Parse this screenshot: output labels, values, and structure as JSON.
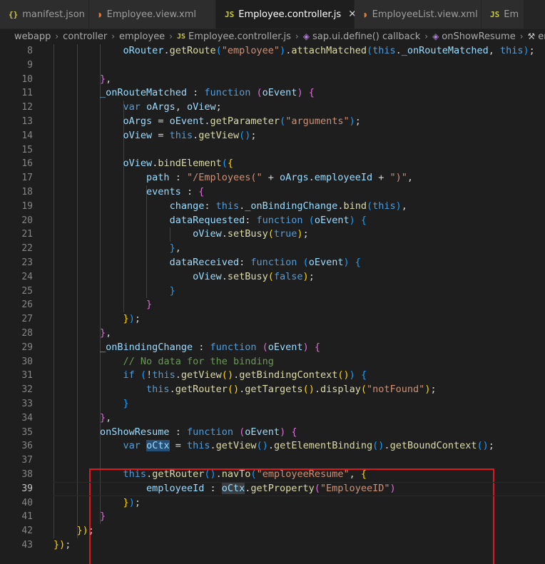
{
  "tabs": [
    {
      "icon": "{}",
      "label": "manifest.json"
    },
    {
      "icon": "RSS",
      "label": "Employee.view.xml"
    },
    {
      "icon": "JS",
      "label": "Employee.controller.js",
      "active": true
    },
    {
      "icon": "RSS",
      "label": "EmployeeList.view.xml"
    },
    {
      "icon": "JS",
      "label": "Em"
    }
  ],
  "breadcrumb": [
    "webapp",
    "controller",
    "employee",
    "Employee.controller.js",
    "sap.ui.define() callback",
    "onShowResume",
    "emplo"
  ],
  "breadcrumb_icons": {
    "js": "JS",
    "symbol": "◈",
    "wrench": "🔧"
  },
  "editor": {
    "current_line": 39,
    "lines": [
      {
        "n": "8",
        "t": "            oRouter.getRoute(\"employee\").attachMatched(this._onRouteMatched, this);"
      },
      {
        "n": "9",
        "t": ""
      },
      {
        "n": "10",
        "t": "        },"
      },
      {
        "n": "11",
        "t": "        _onRouteMatched : function (oEvent) {"
      },
      {
        "n": "12",
        "t": "            var oArgs, oView;"
      },
      {
        "n": "13",
        "t": "            oArgs = oEvent.getParameter(\"arguments\");"
      },
      {
        "n": "14",
        "t": "            oView = this.getView();"
      },
      {
        "n": "15",
        "t": ""
      },
      {
        "n": "16",
        "t": "            oView.bindElement({"
      },
      {
        "n": "17",
        "t": "                path : \"/Employees(\" + oArgs.employeeId + \")\","
      },
      {
        "n": "18",
        "t": "                events : {"
      },
      {
        "n": "19",
        "t": "                    change: this._onBindingChange.bind(this),"
      },
      {
        "n": "20",
        "t": "                    dataRequested: function (oEvent) {"
      },
      {
        "n": "21",
        "t": "                        oView.setBusy(true);"
      },
      {
        "n": "22",
        "t": "                    },"
      },
      {
        "n": "23",
        "t": "                    dataReceived: function (oEvent) {"
      },
      {
        "n": "24",
        "t": "                        oView.setBusy(false);"
      },
      {
        "n": "25",
        "t": "                    }"
      },
      {
        "n": "26",
        "t": "                }"
      },
      {
        "n": "27",
        "t": "            });"
      },
      {
        "n": "28",
        "t": "        },"
      },
      {
        "n": "29",
        "t": "        _onBindingChange : function (oEvent) {"
      },
      {
        "n": "30",
        "t": "            // No data for the binding"
      },
      {
        "n": "31",
        "t": "            if (!this.getView().getBindingContext()) {"
      },
      {
        "n": "32",
        "t": "                this.getRouter().getTargets().display(\"notFound\");"
      },
      {
        "n": "33",
        "t": "            }"
      },
      {
        "n": "34",
        "t": "        },"
      },
      {
        "n": "35",
        "t": "        onShowResume : function (oEvent) {"
      },
      {
        "n": "36",
        "t": "            var oCtx = this.getView().getElementBinding().getBoundContext();"
      },
      {
        "n": "37",
        "t": ""
      },
      {
        "n": "38",
        "t": "            this.getRouter().navTo(\"employeeResume\", {"
      },
      {
        "n": "39",
        "t": "                employeeId : oCtx.getProperty(\"EmployeeID\")"
      },
      {
        "n": "40",
        "t": "            });"
      },
      {
        "n": "41",
        "t": "        }"
      },
      {
        "n": "42",
        "t": "    });"
      },
      {
        "n": "43",
        "t": "});"
      }
    ]
  },
  "colors": {
    "background": "#1e1e1e",
    "highlight_box": "#e0161f",
    "keyword": "#569cd6",
    "function": "#dcdcaa",
    "string": "#ce9178",
    "variable": "#9cdcfe",
    "comment": "#6a9955"
  }
}
